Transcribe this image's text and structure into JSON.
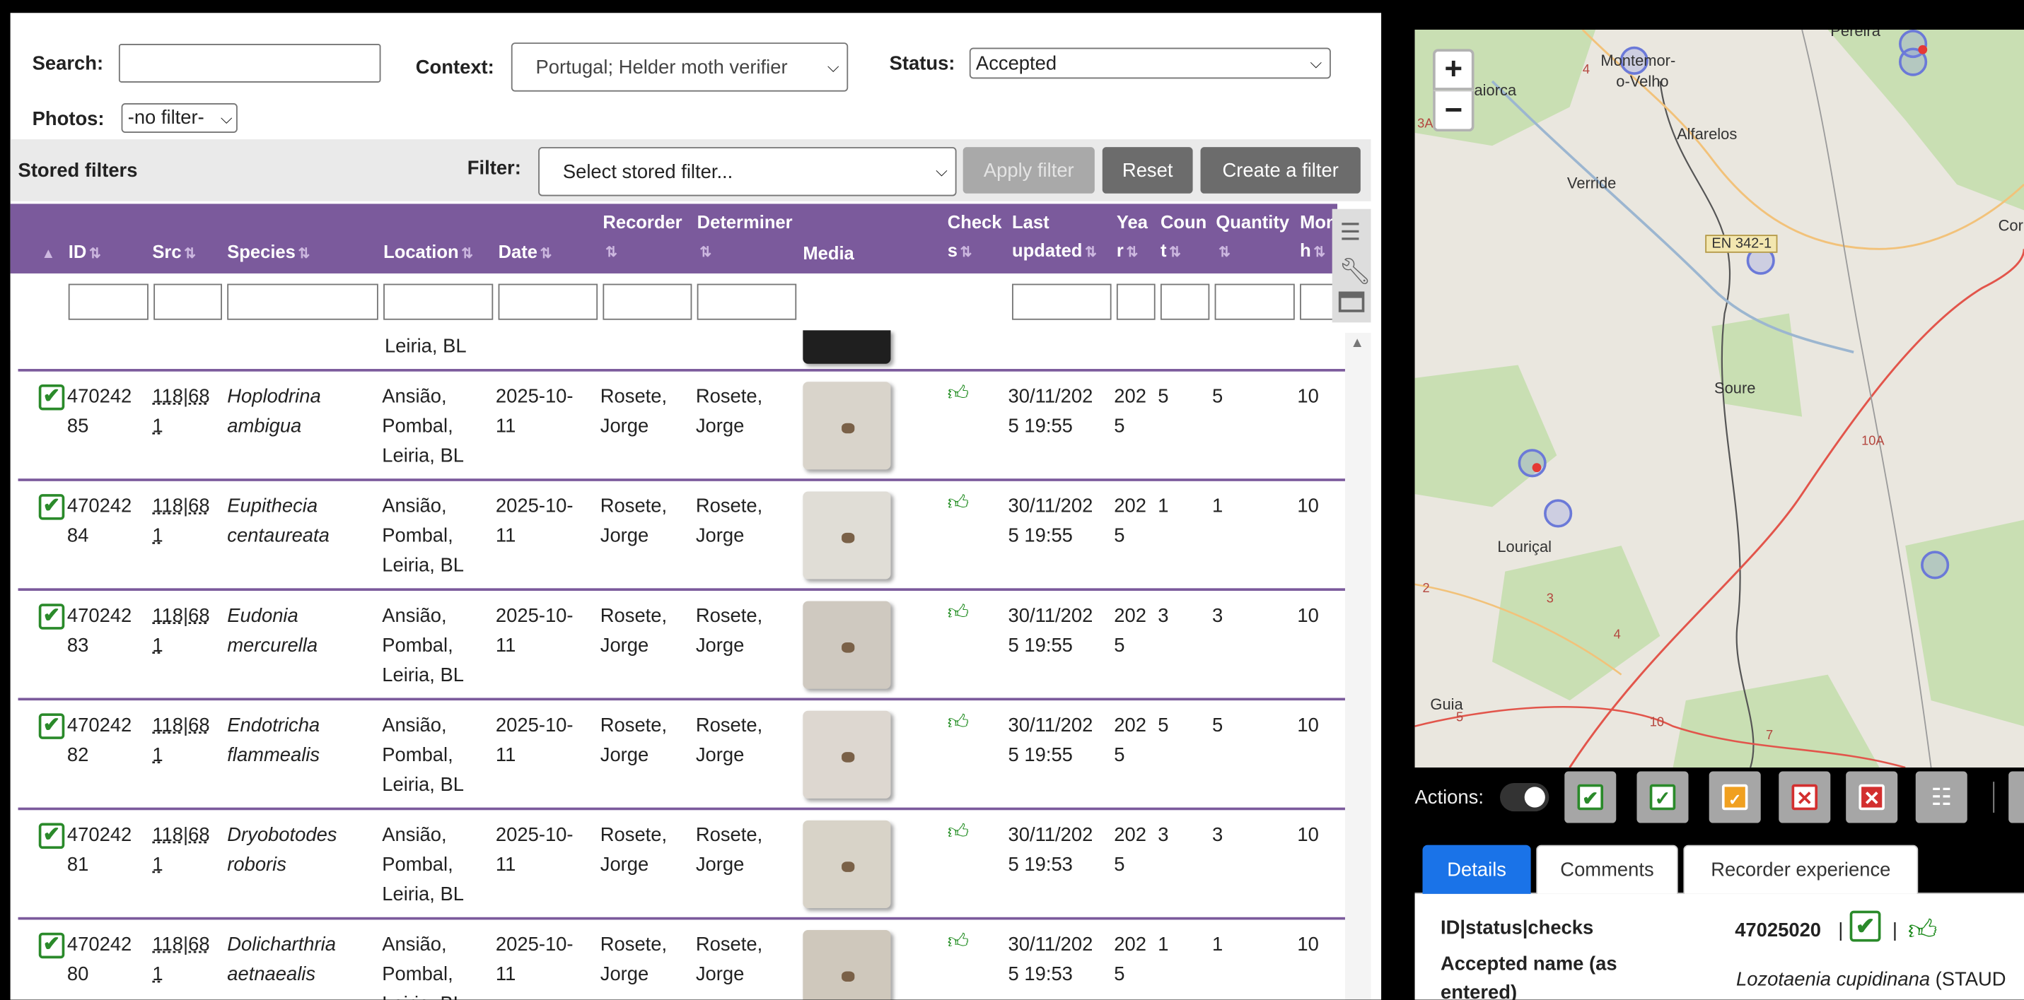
{
  "search": {
    "label": "Search:",
    "value": ""
  },
  "context": {
    "label": "Context:",
    "value": "Portugal; Helder moth verifier"
  },
  "status": {
    "label": "Status:",
    "value": "Accepted"
  },
  "photos": {
    "label": "Photos:",
    "value": "-no filter-"
  },
  "stored_filters": {
    "label": "Stored filters",
    "filter_label": "Filter:",
    "filter_value": "Select stored filter...",
    "apply": "Apply filter",
    "reset": "Reset",
    "create": "Create a filter"
  },
  "columns": {
    "id": "ID",
    "src": "Src",
    "species": "Species",
    "location": "Location",
    "date": "Date",
    "recorder": "Recorder",
    "determiner": "Determiner",
    "media": "Media",
    "checks_1": "Check",
    "checks_2": "s",
    "last_updated_1": "Last",
    "last_updated_2": "updated",
    "year_1": "Yea",
    "year_2": "r",
    "count_1": "Coun",
    "count_2": "t",
    "quantity": "Quantity",
    "month_1": "Mon",
    "month_2": "h"
  },
  "partial_row": {
    "location": "Leiria, BL"
  },
  "rows": [
    {
      "id1": "470242",
      "id2": "85",
      "src1": "118|68",
      "src2": "1",
      "sp1": "Hoplodrina",
      "sp2": "ambigua",
      "loc1": "Ansião,",
      "loc2": "Pombal,",
      "loc3": "Leiria, BL",
      "date1": "2025-10-",
      "date2": "11",
      "rec1": "Rosete,",
      "rec2": "Jorge",
      "det1": "Rosete,",
      "det2": "Jorge",
      "upd1": "30/11/202",
      "upd2": "5 19:55",
      "yr1": "202",
      "yr2": "5",
      "count": "5",
      "qty": "5",
      "month": "10"
    },
    {
      "id1": "470242",
      "id2": "84",
      "src1": "118|68",
      "src2": "1",
      "sp1": "Eupithecia",
      "sp2": "centaureata",
      "loc1": "Ansião,",
      "loc2": "Pombal,",
      "loc3": "Leiria, BL",
      "date1": "2025-10-",
      "date2": "11",
      "rec1": "Rosete,",
      "rec2": "Jorge",
      "det1": "Rosete,",
      "det2": "Jorge",
      "upd1": "30/11/202",
      "upd2": "5 19:55",
      "yr1": "202",
      "yr2": "5",
      "count": "1",
      "qty": "1",
      "month": "10"
    },
    {
      "id1": "470242",
      "id2": "83",
      "src1": "118|68",
      "src2": "1",
      "sp1": "Eudonia",
      "sp2": "mercurella",
      "loc1": "Ansião,",
      "loc2": "Pombal,",
      "loc3": "Leiria, BL",
      "date1": "2025-10-",
      "date2": "11",
      "rec1": "Rosete,",
      "rec2": "Jorge",
      "det1": "Rosete,",
      "det2": "Jorge",
      "upd1": "30/11/202",
      "upd2": "5 19:55",
      "yr1": "202",
      "yr2": "5",
      "count": "3",
      "qty": "3",
      "month": "10"
    },
    {
      "id1": "470242",
      "id2": "82",
      "src1": "118|68",
      "src2": "1",
      "sp1": "Endotricha",
      "sp2": "flammealis",
      "loc1": "Ansião,",
      "loc2": "Pombal,",
      "loc3": "Leiria, BL",
      "date1": "2025-10-",
      "date2": "11",
      "rec1": "Rosete,",
      "rec2": "Jorge",
      "det1": "Rosete,",
      "det2": "Jorge",
      "upd1": "30/11/202",
      "upd2": "5 19:55",
      "yr1": "202",
      "yr2": "5",
      "count": "5",
      "qty": "5",
      "month": "10"
    },
    {
      "id1": "470242",
      "id2": "81",
      "src1": "118|68",
      "src2": "1",
      "sp1": "Dryobotodes",
      "sp2": "roboris",
      "loc1": "Ansião,",
      "loc2": "Pombal,",
      "loc3": "Leiria, BL",
      "date1": "2025-10-",
      "date2": "11",
      "rec1": "Rosete,",
      "rec2": "Jorge",
      "det1": "Rosete,",
      "det2": "Jorge",
      "upd1": "30/11/202",
      "upd2": "5 19:53",
      "yr1": "202",
      "yr2": "5",
      "count": "3",
      "qty": "3",
      "month": "10"
    },
    {
      "id1": "470242",
      "id2": "80",
      "src1": "118|68",
      "src2": "1",
      "sp1": "Dolicharthria",
      "sp2": "aetnaealis",
      "loc1": "Ansião,",
      "loc2": "Pombal,",
      "loc3": "Leiria, BL",
      "date1": "2025-10-",
      "date2": "11",
      "rec1": "Rosete,",
      "rec2": "Jorge",
      "det1": "Rosete,",
      "det2": "Jorge",
      "upd1": "30/11/202",
      "upd2": "5 19:53",
      "yr1": "202",
      "yr2": "5",
      "count": "1",
      "qty": "1",
      "month": "10"
    }
  ],
  "map": {
    "zoom_in": "+",
    "zoom_out": "−",
    "places": [
      "Pereira",
      "Montemor-",
      "o-Velho",
      "aiorca",
      "Alfarelos",
      "Verride",
      "EN 342-1",
      "Cor",
      "Soure",
      "Louriçal",
      "Guia",
      "10A",
      "3A",
      "4",
      "2",
      "3",
      "4",
      "10",
      "7",
      "5"
    ]
  },
  "actions": {
    "label": "Actions:"
  },
  "tabs": {
    "details": "Details",
    "comments": "Comments",
    "recorder_experience": "Recorder experience"
  },
  "details": {
    "id_status_label": "ID|status|checks",
    "id_value": "47025020",
    "sep": "|",
    "accepted_label_1": "Accepted name (as",
    "accepted_label_2": "entered)",
    "accepted_name": "Lozotaenia cupidinana",
    "accepted_author": "(STAUD"
  },
  "colors": {
    "header_purple": "#7b5a9c",
    "accent_blue": "#1a73e8",
    "check_green": "#2a8a2a",
    "button_grey": "#6c6c6c"
  }
}
